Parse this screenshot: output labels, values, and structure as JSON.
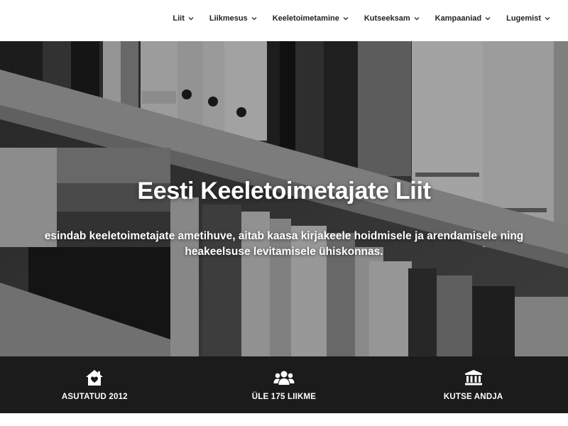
{
  "nav": {
    "items": [
      {
        "label": "Liit"
      },
      {
        "label": "Liikmesus"
      },
      {
        "label": "Keeletoimetamine"
      },
      {
        "label": "Kutseeksam"
      },
      {
        "label": "Kampaaniad"
      },
      {
        "label": "Lugemist"
      }
    ],
    "chevron_icon": "chevron-down-icon"
  },
  "hero": {
    "title": "Eesti Keeletoimetajate Liit",
    "subtitle": "esindab keeletoimetajate ametihuve, aitab kaasa kirjakeele hoidmisele ja arendamisele ning heakeelsuse levitamisele ühiskonnas.",
    "background": "grayscale photo of bookshelves"
  },
  "features": [
    {
      "icon": "home-heart-icon",
      "label": "ASUTATUD 2012"
    },
    {
      "icon": "users-icon",
      "label": "ÜLE 175 LIIKME"
    },
    {
      "icon": "landmark-icon",
      "label": "KUTSE ANDJA"
    }
  ],
  "colors": {
    "header_bg": "#ffffff",
    "nav_text": "#222222",
    "hero_text": "#ffffff",
    "features_bg": "#1b1b1b",
    "features_text": "#ffffff"
  }
}
